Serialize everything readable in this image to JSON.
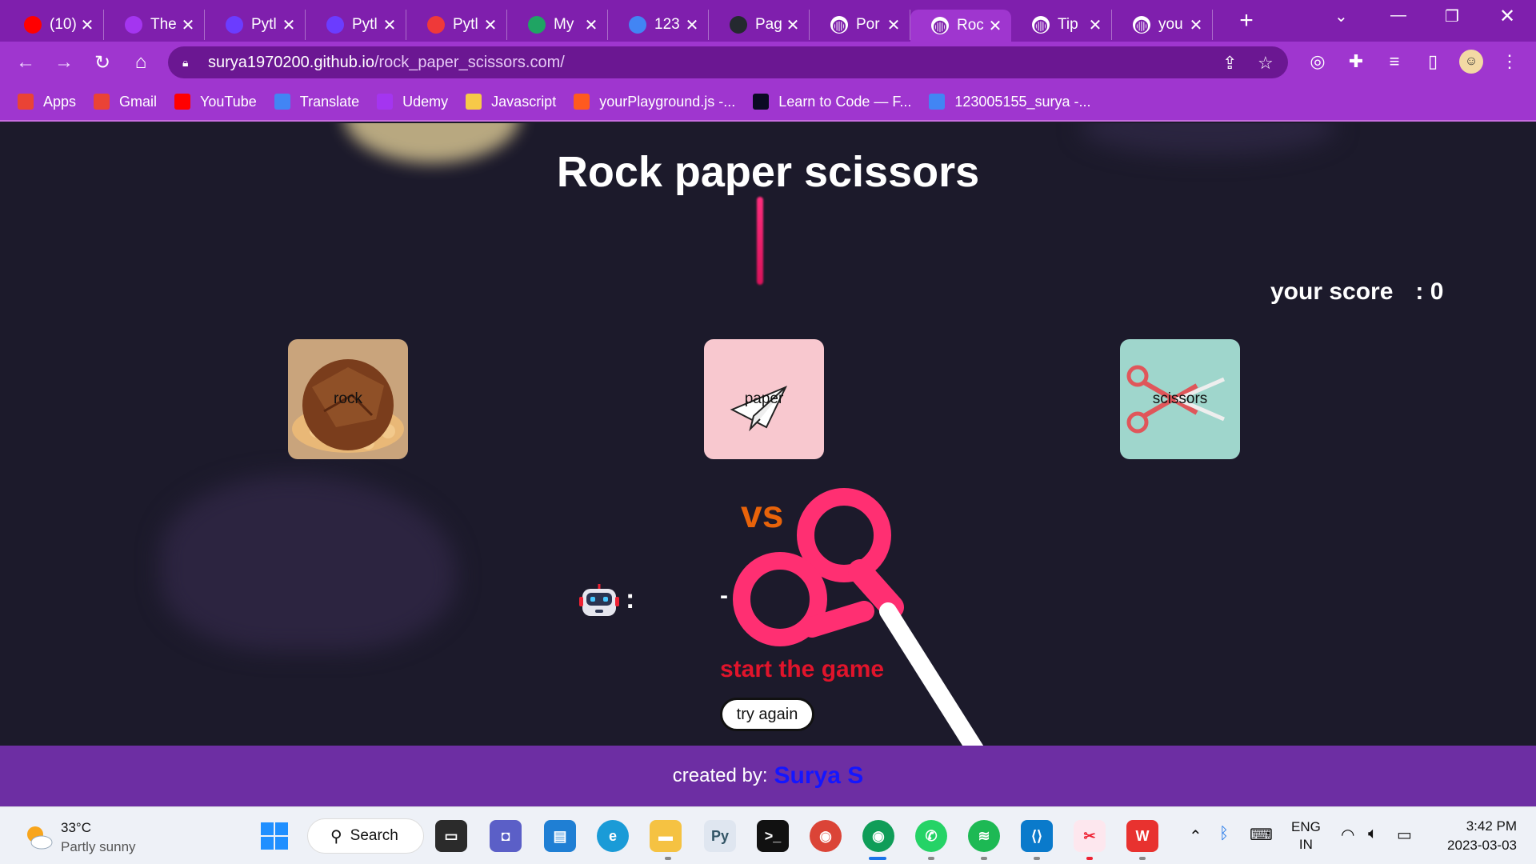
{
  "browser": {
    "tabs": [
      {
        "title": "(10)",
        "icon": "youtube-icon",
        "color": "#ff0000"
      },
      {
        "title": "The",
        "icon": "udemy-icon",
        "color": "#a435f0"
      },
      {
        "title": "Pytl",
        "icon": "pycharm-icon",
        "color": "#6b3cff"
      },
      {
        "title": "Pytl",
        "icon": "pycharm-icon",
        "color": "#6b3cff"
      },
      {
        "title": "Pytl",
        "icon": "vivaldi-icon",
        "color": "#ef3939"
      },
      {
        "title": "My",
        "icon": "drive-icon",
        "color": "#1fa463"
      },
      {
        "title": "123",
        "icon": "docs-icon",
        "color": "#4285f4"
      },
      {
        "title": "Pag",
        "icon": "github-icon",
        "color": "#24292f"
      },
      {
        "title": "Por",
        "icon": "globe-icon",
        "color": "#ffffff"
      },
      {
        "title": "Roc",
        "icon": "globe-icon",
        "color": "#ffffff",
        "active": true
      },
      {
        "title": "Tip",
        "icon": "globe-icon",
        "color": "#ffffff"
      },
      {
        "title": "you",
        "icon": "globe-icon",
        "color": "#ffffff"
      }
    ],
    "url_host": "surya1970200.github.io",
    "url_path": "/rock_paper_scissors.com/",
    "bookmarks": [
      {
        "label": "Apps",
        "icon": "apps-grid-icon",
        "color": "#ea4335"
      },
      {
        "label": "Gmail",
        "icon": "gmail-icon",
        "color": "#ea4335"
      },
      {
        "label": "YouTube",
        "icon": "youtube-icon",
        "color": "#ff0000"
      },
      {
        "label": "Translate",
        "icon": "translate-icon",
        "color": "#4285f4"
      },
      {
        "label": "Udemy",
        "icon": "udemy-icon",
        "color": "#a435f0"
      },
      {
        "label": "Javascript",
        "icon": "avatar-icon",
        "color": "#f7c948"
      },
      {
        "label": "yourPlayground.js -...",
        "icon": "playground-icon",
        "color": "#ff5a1f"
      },
      {
        "label": "Learn to Code — F...",
        "icon": "freecodecamp-icon",
        "color": "#0a0a23"
      },
      {
        "label": "123005155_surya -...",
        "icon": "docs-icon",
        "color": "#4285f4"
      }
    ]
  },
  "game": {
    "title": "Rock paper scissors",
    "score_label": "your score",
    "score_value": ": 0",
    "choices": [
      {
        "label": "rock",
        "color": "#c9a47c"
      },
      {
        "label": "paper",
        "color": "#f8c8cf"
      },
      {
        "label": "scissors",
        "color": "#9fd6cc"
      }
    ],
    "vs_text": "vs",
    "computer_colon": ":",
    "computer_choice": "-",
    "result": "start the game",
    "try_again": "try again"
  },
  "footer": {
    "prefix": "created by:",
    "author": "Surya S"
  },
  "taskbar": {
    "temperature": "33°C",
    "weather": "Partly sunny",
    "search": "Search",
    "lang1": "ENG",
    "lang2": "IN",
    "time": "3:42 PM",
    "date": "2023-03-03"
  }
}
